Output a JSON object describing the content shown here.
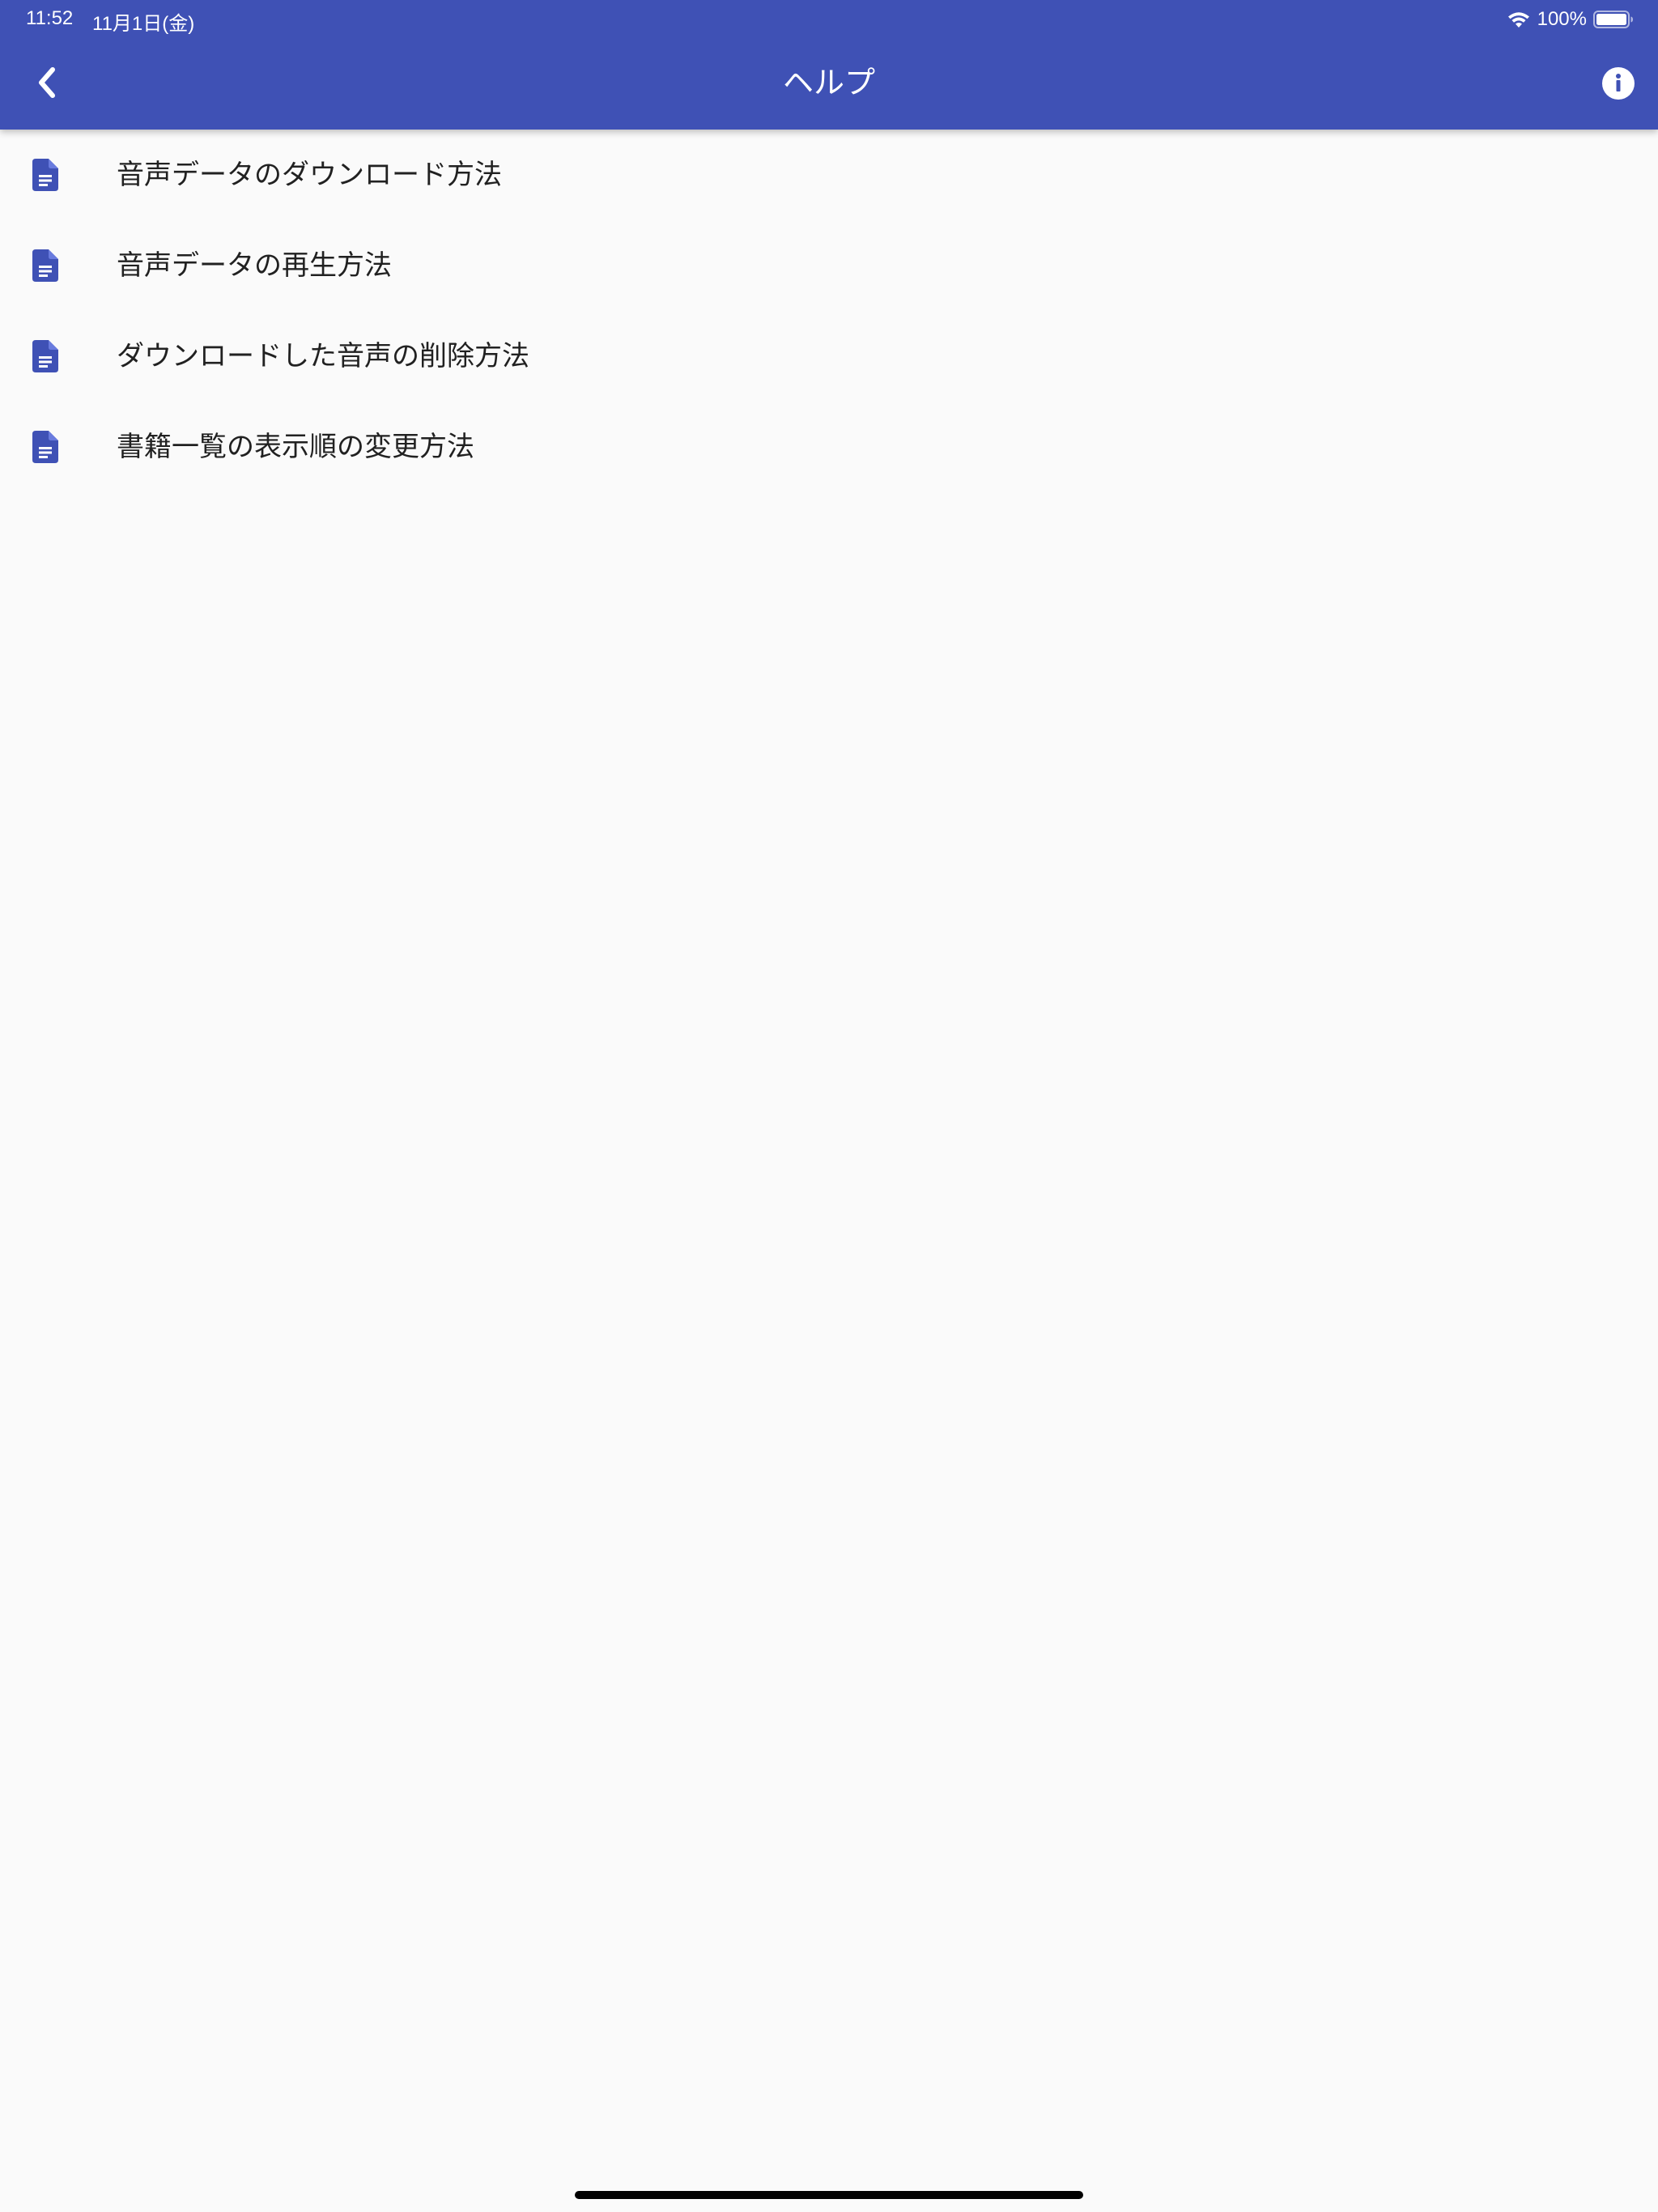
{
  "status_bar": {
    "time": "11:52",
    "date": "11月1日(金)",
    "battery": "100%"
  },
  "app_bar": {
    "title": "ヘルプ",
    "back_icon": "chevron-left-icon",
    "info_icon": "info-icon",
    "color": "#3f51b5"
  },
  "help_items": [
    {
      "label": "音声データのダウンロード方法",
      "icon": "document-icon"
    },
    {
      "label": "音声データの再生方法",
      "icon": "document-icon"
    },
    {
      "label": "ダウンロードした音声の削除方法",
      "icon": "document-icon"
    },
    {
      "label": "書籍一覧の表示順の変更方法",
      "icon": "document-icon"
    }
  ],
  "colors": {
    "primary": "#3f51b5",
    "background": "#fafafa",
    "text": "#212121"
  }
}
